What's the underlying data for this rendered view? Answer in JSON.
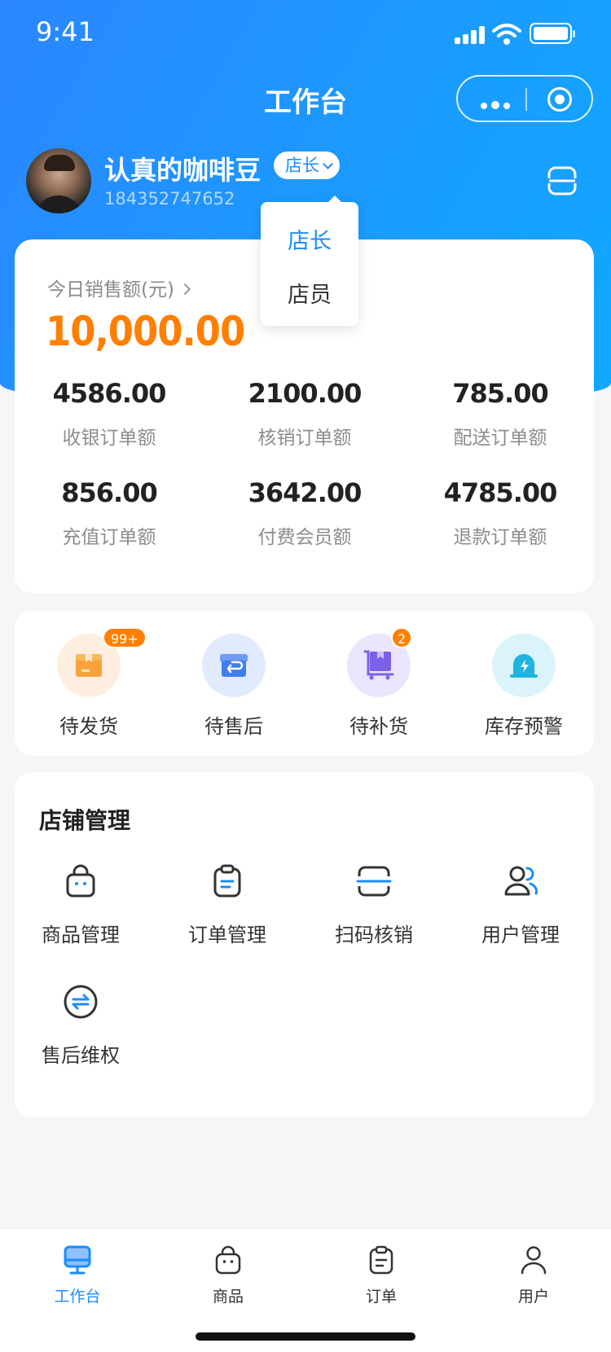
{
  "status_bar": {
    "time": "9:41"
  },
  "nav": {
    "title": "工作台"
  },
  "user": {
    "name": "认真的咖啡豆",
    "role": "店长",
    "phone": "184352747652"
  },
  "role_dropdown": {
    "options": [
      "店长",
      "店员"
    ],
    "selected": "店长"
  },
  "sales": {
    "label": "今日销售额(元)",
    "value": "10,000.00",
    "stats": [
      {
        "value": "4586.00",
        "label": "收银订单额"
      },
      {
        "value": "2100.00",
        "label": "核销订单额"
      },
      {
        "value": "785.00",
        "label": "配送订单额"
      },
      {
        "value": "856.00",
        "label": "充值订单额"
      },
      {
        "value": "3642.00",
        "label": "付费会员额"
      },
      {
        "value": "4785.00",
        "label": "退款订单额"
      }
    ]
  },
  "quick_actions": [
    {
      "label": "待发货",
      "badge": "99+",
      "icon": "package-icon"
    },
    {
      "label": "待售后",
      "badge": "",
      "icon": "return-box-icon"
    },
    {
      "label": "待补货",
      "badge": "2",
      "icon": "restock-cart-icon"
    },
    {
      "label": "库存预警",
      "badge": "",
      "icon": "alarm-icon"
    }
  ],
  "store": {
    "title": "店铺管理",
    "tools": [
      {
        "label": "商品管理",
        "icon": "bag-icon"
      },
      {
        "label": "订单管理",
        "icon": "clipboard-icon"
      },
      {
        "label": "扫码核销",
        "icon": "scan-icon"
      },
      {
        "label": "用户管理",
        "icon": "users-icon"
      },
      {
        "label": "售后维权",
        "icon": "exchange-icon"
      }
    ]
  },
  "tabbar": [
    {
      "label": "工作台",
      "icon": "monitor-icon",
      "active": true
    },
    {
      "label": "商品",
      "icon": "bag-icon"
    },
    {
      "label": "订单",
      "icon": "clipboard-icon"
    },
    {
      "label": "用户",
      "icon": "user-icon"
    }
  ],
  "colors": {
    "primary": "#1a8cff",
    "accent": "#ff7f00",
    "background": "#f5f6f8"
  }
}
